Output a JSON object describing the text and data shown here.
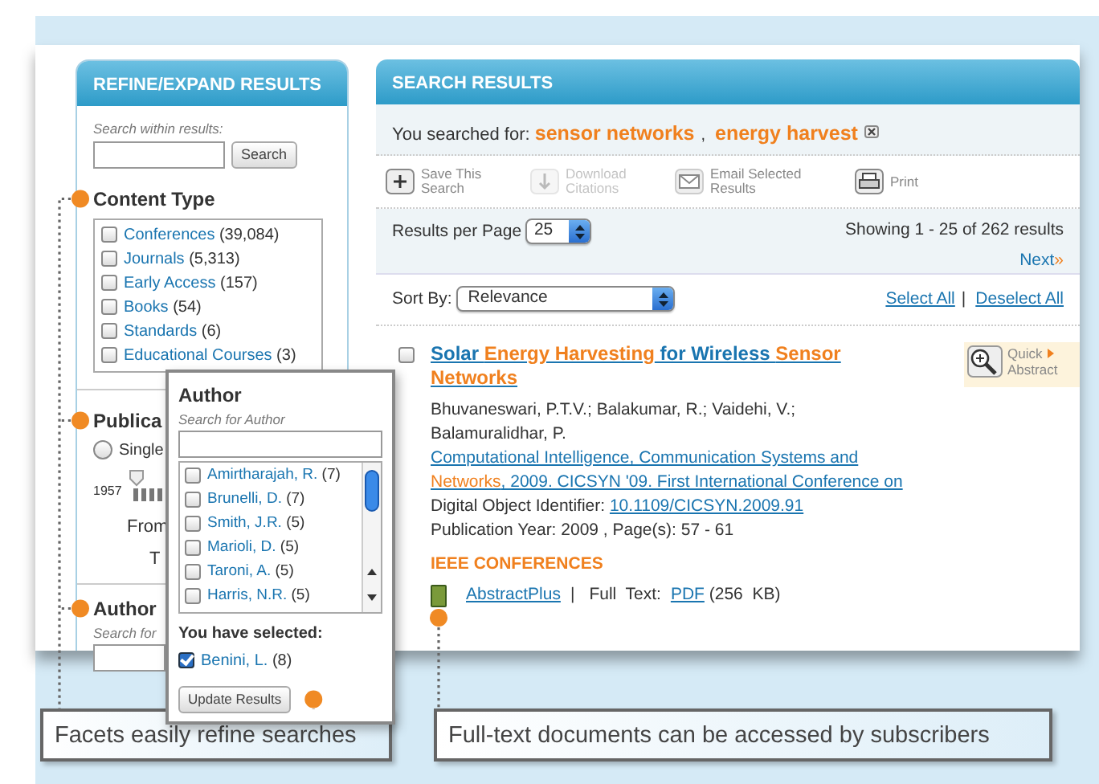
{
  "refine_panel": {
    "title": "REFINE/EXPAND RESULTS",
    "search_label": "Search within results:",
    "search_button": "Search",
    "content_type": {
      "title": "Content Type",
      "items": [
        {
          "label": "Conferences",
          "count": "(39,084)",
          "checked": false
        },
        {
          "label": "Journals",
          "count": "(5,313)",
          "checked": false
        },
        {
          "label": "Early Access",
          "count": "(157)",
          "checked": false
        },
        {
          "label": "Books",
          "count": "(54)",
          "checked": false
        },
        {
          "label": "Standards",
          "count": "(6)",
          "checked": false
        },
        {
          "label": "Educational Courses",
          "count": "(3)",
          "checked": false
        }
      ]
    },
    "publication_year": {
      "title": "Publica",
      "radio": {
        "label": "Single",
        "selected": false
      },
      "slider_start": "1957",
      "from_label": "From",
      "to_label": "T"
    },
    "author": {
      "title": "Author",
      "hint": "Search for"
    }
  },
  "author_popup": {
    "title": "Author",
    "hint": "Search for Author",
    "items": [
      {
        "label": "Amirtharajah, R.",
        "count": "(7)",
        "checked": false
      },
      {
        "label": "Brunelli, D.",
        "count": "(7)",
        "checked": false
      },
      {
        "label": "Smith, J.R.",
        "count": "(5)",
        "checked": false
      },
      {
        "label": "Marioli, D.",
        "count": "(5)",
        "checked": false
      },
      {
        "label": "Taroni, A.",
        "count": "(5)",
        "checked": false
      },
      {
        "label": "Harris, N.R.",
        "count": "(5)",
        "checked": false
      }
    ],
    "selected_title": "You have selected:",
    "selected_items": [
      {
        "label": "Benini, L.",
        "count": "(8)",
        "checked": true
      }
    ],
    "button": "Update Results"
  },
  "search_results": {
    "title": "SEARCH RESULTS",
    "searched_label": "You searched for:",
    "terms": [
      "sensor networks",
      "energy harvest"
    ],
    "term_separator": ",",
    "toolbar": [
      {
        "kind": "save",
        "label": "Save This Search",
        "disabled": false
      },
      {
        "kind": "download",
        "label": "Download Citations",
        "disabled": true
      },
      {
        "kind": "email",
        "label": "Email Selected Results",
        "disabled": false
      },
      {
        "kind": "print",
        "label": "Print",
        "disabled": false
      }
    ],
    "per_page_label": "Results per Page",
    "per_page": "25",
    "showing": "Showing 1 - 25 of 262 results",
    "next": "Next",
    "next_mark": "»",
    "sort_label": "Sort By:",
    "sort": "Relevance",
    "select_all": "Select All",
    "link_separator": "|",
    "deselect_all": "Deselect All",
    "items": [
      {
        "checked": false,
        "title": [
          {
            "text": "Solar ",
            "highlight": false
          },
          {
            "text": "Energy Harvesting",
            "highlight": true
          },
          {
            "text": " for Wireless ",
            "highlight": false
          },
          {
            "text": "Sensor Networks",
            "highlight": true
          }
        ],
        "quick_abstract": [
          "Quick",
          "Abstract"
        ],
        "authors": "Bhuvaneswari, P.T.V.; Balakumar, R.; Vaidehi, V.; Balamuralidhar, P.",
        "publication": [
          {
            "text": "Computational Intelligence, Communication Systems and ",
            "highlight": false
          },
          {
            "text": "Networks",
            "highlight": true
          },
          {
            "text": ", 2009. CICSYN '09. First International Conference on",
            "highlight": false
          }
        ],
        "doi_label": "Digital Object Identifier:",
        "doi": "10.1109/CICSYN.2009.91",
        "year_pages": "Publication Year: 2009 , Page(s): 57 - 61",
        "source": "IEEE CONFERENCES",
        "abstract_link": "AbstractPlus",
        "separator": "|",
        "fulltext_label": "Full  Text:",
        "pdf_link": "PDF",
        "size": "(256  KB)"
      }
    ]
  },
  "callouts": [
    "Facets easily refine searches",
    "Full-text documents can be accessed by subscribers"
  ]
}
